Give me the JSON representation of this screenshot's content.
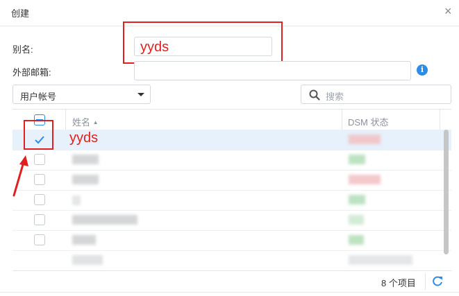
{
  "dialog": {
    "title": "创建",
    "close_glyph": "×"
  },
  "form": {
    "alias_label": "别名:",
    "alias_value": "yyds",
    "email_label": "外部邮箱:",
    "email_value": "",
    "info_glyph": "i"
  },
  "filter": {
    "type_value": "用户帐号",
    "search_placeholder": "搜索"
  },
  "table": {
    "columns": [
      "姓名",
      "DSM 状态"
    ],
    "sort_indicator": "▲",
    "selected_row_name": "yyds"
  },
  "footer": {
    "count_text": "8 个项目"
  },
  "colors": {
    "accent": "#2f8ce6",
    "annotation": "#e02020",
    "selected_row": "#e6f1fc"
  },
  "icons": [
    "close-icon",
    "info-icon",
    "chevron-down-icon",
    "search-icon",
    "check-icon",
    "refresh-icon",
    "arrow-annotation"
  ]
}
